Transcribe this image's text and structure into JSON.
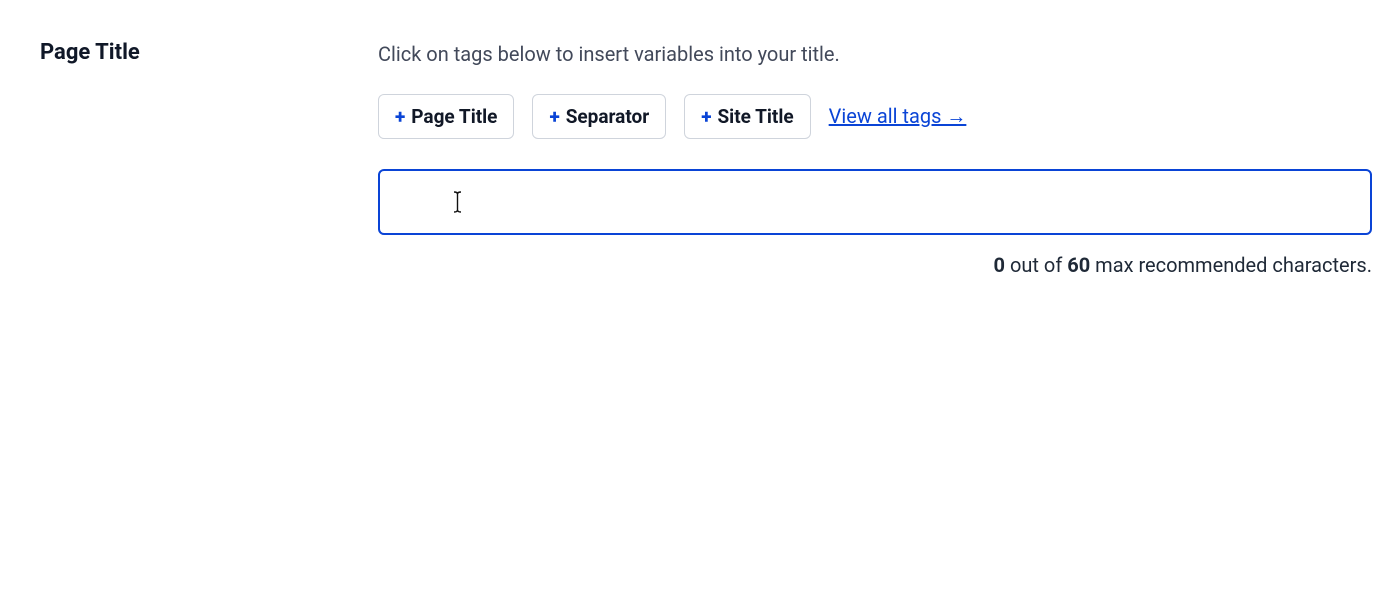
{
  "label": "Page Title",
  "description": "Click on tags below to insert variables into your title.",
  "tags": [
    {
      "label": "Page Title"
    },
    {
      "label": "Separator"
    },
    {
      "label": "Site Title"
    }
  ],
  "view_all": "View all tags →",
  "input": {
    "value": "",
    "placeholder": ""
  },
  "counter": {
    "count": "0",
    "mid1": " out of ",
    "max": "60",
    "mid2": " max recommended characters."
  }
}
